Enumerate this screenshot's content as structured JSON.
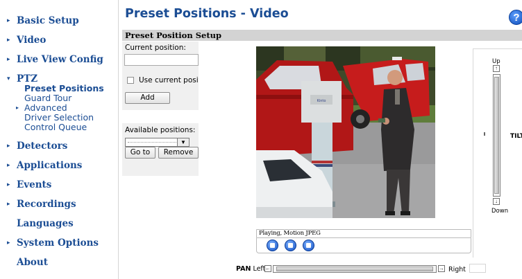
{
  "sidebar": {
    "items": [
      {
        "label": "Basic Setup",
        "arrow": "▸"
      },
      {
        "label": "Video",
        "arrow": "▸"
      },
      {
        "label": "Live View Config",
        "arrow": "▸"
      },
      {
        "label": "PTZ",
        "arrow": "▾"
      },
      {
        "label": "Detectors",
        "arrow": "▸"
      },
      {
        "label": "Applications",
        "arrow": "▸"
      },
      {
        "label": "Events",
        "arrow": "▸"
      },
      {
        "label": "Recordings",
        "arrow": "▸"
      },
      {
        "label": "Languages",
        "arrow": ""
      },
      {
        "label": "System Options",
        "arrow": "▸"
      },
      {
        "label": "About",
        "arrow": ""
      }
    ],
    "ptz_subitems": [
      {
        "label": "Preset Positions",
        "active": true
      },
      {
        "label": "Guard Tour",
        "active": false
      },
      {
        "label": "Advanced",
        "active": false,
        "arrow": "▸"
      },
      {
        "label": "Driver Selection",
        "active": false
      },
      {
        "label": "Control Queue",
        "active": false
      }
    ]
  },
  "header": {
    "title": "Preset Positions - Video",
    "help_glyph": "?"
  },
  "setup": {
    "section_title": "Preset Position Setup",
    "current_position_label": "Current position:",
    "current_position_value": "",
    "use_current_label": "Use current position",
    "use_current_checked": false,
    "add_label": "Add",
    "available_label": "Available positions:",
    "available_selected": "",
    "goto_label": "Go to",
    "remove_label": "Remove"
  },
  "video": {
    "status_text": "Playing, Motion JPEG",
    "controls": [
      "stop-icon",
      "snapshot-icon",
      "view-full-icon"
    ],
    "sign_text": "Kinto"
  },
  "ptz": {
    "pan_label": "PAN",
    "left_label": "Left",
    "right_label": "Right",
    "left_arrow": "←",
    "right_arrow": "→",
    "up_label": "Up",
    "down_label": "Down",
    "up_arrow": "↑",
    "down_arrow": "↓",
    "tilt_label": "TILT"
  },
  "colors": {
    "nav_link": "#1b4d94",
    "section_bar": "#d3d3d3",
    "panel_bg": "#f0f0f0"
  }
}
